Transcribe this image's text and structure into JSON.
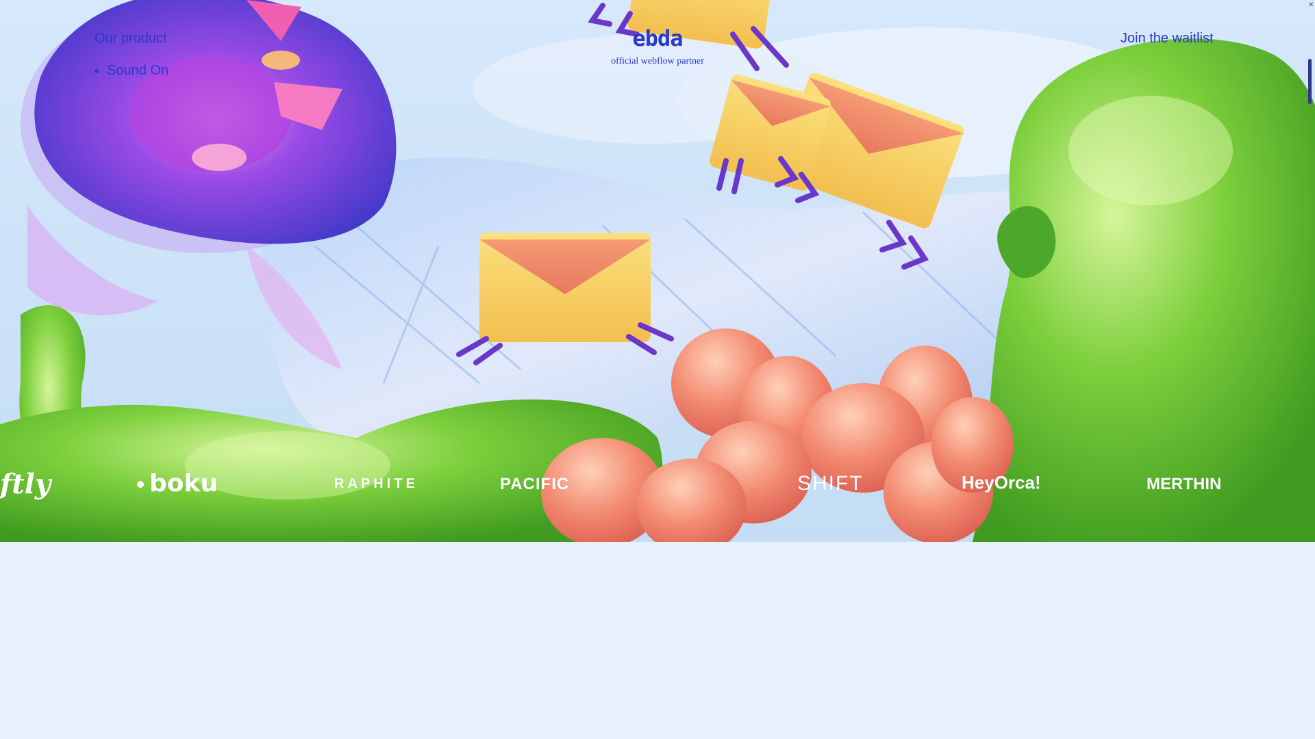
{
  "nav": {
    "product_label": "Our product",
    "sound_label": "Sound On",
    "waitlist_label": "Join the waitlist"
  },
  "brand": {
    "logo_text": "ebda",
    "tagline": "official webflow partner"
  },
  "logos": {
    "items": [
      "ftly",
      "boku",
      "RAPHITE",
      "PACIFIC",
      "SHIFT",
      "HeyOrca!",
      "MERTHIN"
    ]
  },
  "colors": {
    "accent": "#2a39c9",
    "background": "#e8f2fc",
    "envelope": "#f6cc63",
    "envelope_flap": "#ec8e6a",
    "motion_lines": "#6a37c9"
  },
  "icons": {
    "envelope": "envelope-icon",
    "close": "close-icon"
  }
}
